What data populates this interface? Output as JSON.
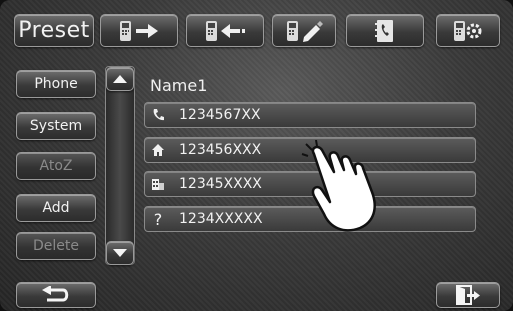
{
  "toolbar": {
    "preset_label": "Preset",
    "buttons": [
      "phone-send-icon",
      "phone-receive-icon",
      "phone-edit-icon",
      "phonebook-icon",
      "phone-settings-icon"
    ]
  },
  "sidebar": {
    "phone_label": "Phone",
    "system_label": "System",
    "atoz_label": "AtoZ",
    "add_label": "Add",
    "delete_label": "Delete"
  },
  "list": {
    "title": "Name1",
    "entries": [
      {
        "type": "mobile-icon",
        "number": "1234567XX"
      },
      {
        "type": "home-icon",
        "number": "123456XXX"
      },
      {
        "type": "office-icon",
        "number": "12345XXXX"
      },
      {
        "type": "unknown-icon",
        "number": "1234XXXXX"
      }
    ]
  }
}
